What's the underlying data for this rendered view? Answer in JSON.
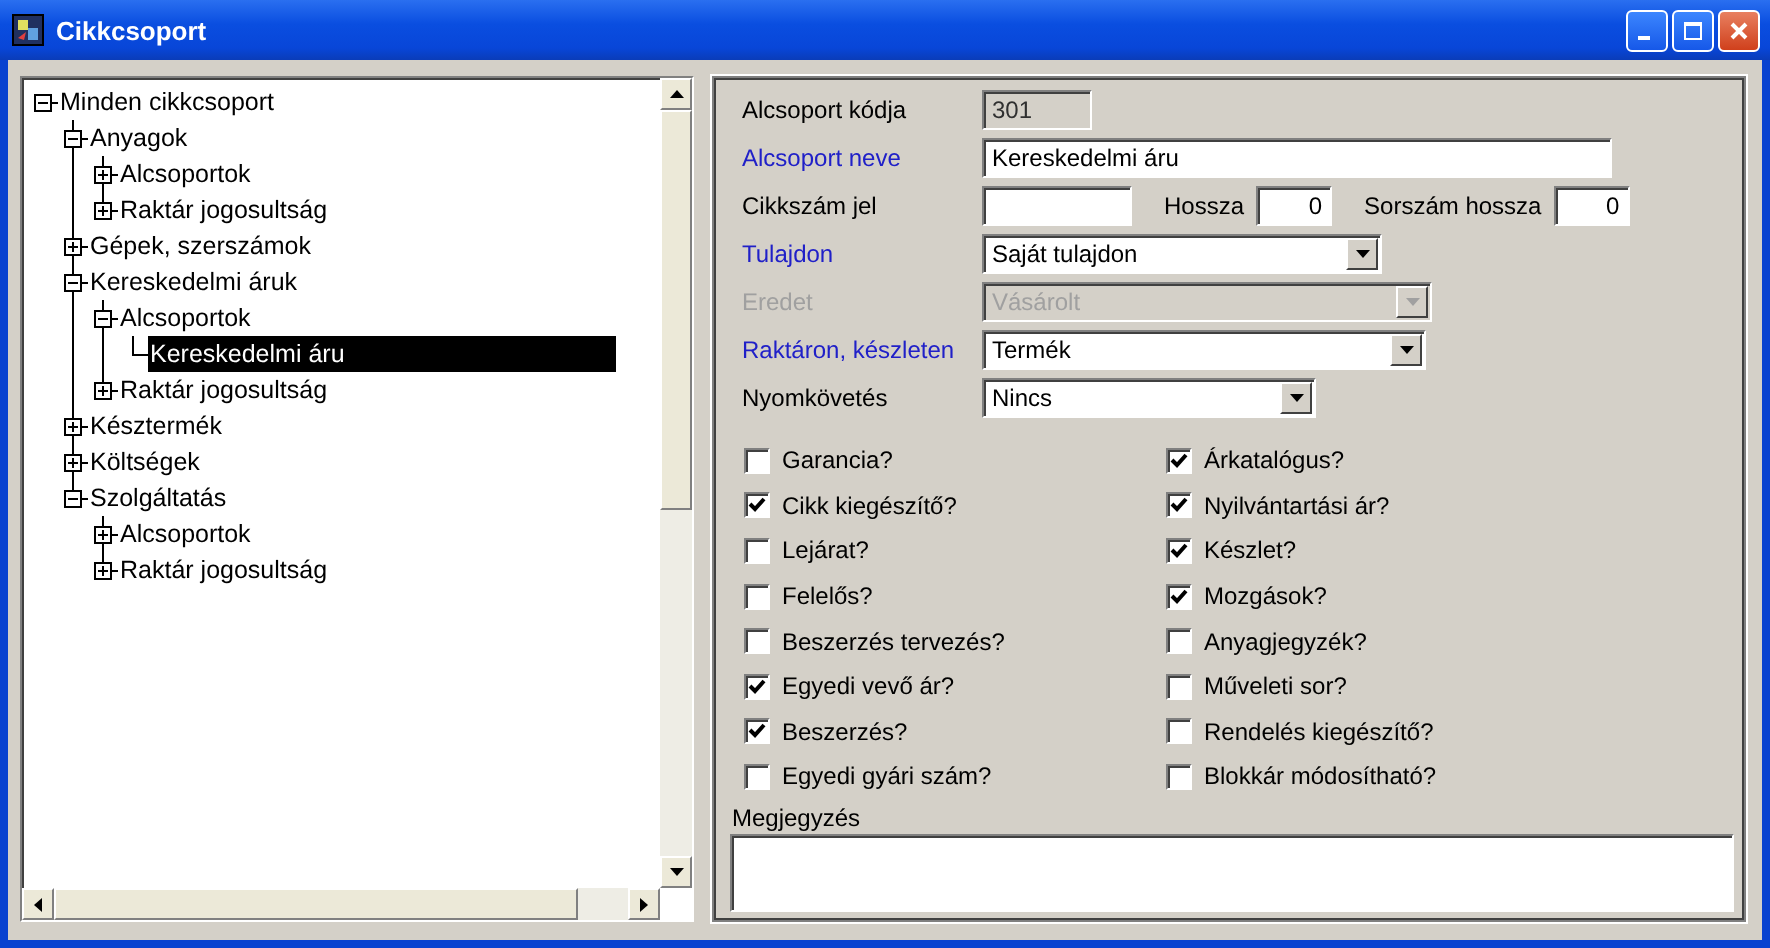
{
  "window": {
    "title": "Cikkcsoport"
  },
  "tree": [
    {
      "label": "Minden cikkcsoport",
      "expanded": true,
      "selected": false,
      "children": [
        {
          "label": "Anyagok",
          "expanded": true,
          "selected": false,
          "children": [
            {
              "label": "Alcsoportok",
              "expanded": false,
              "selected": false
            },
            {
              "label": "Raktár jogosultság",
              "expanded": false,
              "selected": false
            }
          ]
        },
        {
          "label": "Gépek, szerszámok",
          "expanded": false,
          "selected": false
        },
        {
          "label": "Kereskedelmi áruk",
          "expanded": true,
          "selected": false,
          "children": [
            {
              "label": "Alcsoportok",
              "expanded": true,
              "selected": false,
              "children": [
                {
                  "label": "Kereskedelmi áru",
                  "selected": true
                }
              ]
            },
            {
              "label": "Raktár jogosultság",
              "expanded": false,
              "selected": false
            }
          ]
        },
        {
          "label": "Késztermék",
          "expanded": false,
          "selected": false
        },
        {
          "label": "Költségek",
          "expanded": false,
          "selected": false
        },
        {
          "label": "Szolgáltatás",
          "expanded": true,
          "selected": false,
          "children": [
            {
              "label": "Alcsoportok",
              "expanded": false,
              "selected": false
            },
            {
              "label": "Raktár jogosultság",
              "expanded": false,
              "selected": false
            }
          ]
        }
      ]
    }
  ],
  "form": {
    "rows": [
      [
        {
          "label": "Alcsoport kódja",
          "kind": "readonly",
          "value": "301",
          "required": false,
          "disabled": false
        }
      ],
      [
        {
          "label": "Alcsoport neve",
          "kind": "text",
          "value": "Kereskedelmi áru",
          "required": true,
          "disabled": false
        }
      ],
      [
        {
          "label": "Cikkszám jel",
          "kind": "text",
          "required": false,
          "disabled": false
        },
        {
          "label": "Hossza",
          "kind": "number",
          "value": "0",
          "required": false,
          "disabled": false
        },
        {
          "label": "Sorszám hossza",
          "kind": "number",
          "value": "0",
          "required": false,
          "disabled": false
        }
      ],
      [
        {
          "label": "Tulajdon",
          "kind": "dropdown",
          "value": "Saját tulajdon",
          "required": true,
          "disabled": false
        }
      ],
      [
        {
          "label": "Eredet",
          "kind": "dropdown",
          "value": "Vásárolt",
          "required": false,
          "disabled": true
        }
      ],
      [
        {
          "label": "Raktáron, készleten",
          "kind": "dropdown",
          "value": "Termék",
          "required": true,
          "disabled": false
        }
      ],
      [
        {
          "label": "Nyomkövetés",
          "kind": "dropdown",
          "value": "Nincs",
          "required": false,
          "disabled": false
        }
      ]
    ],
    "checks": [
      {
        "label": "Garancia?",
        "checked": false
      },
      {
        "label": "Cikk kiegészítő?",
        "checked": true
      },
      {
        "label": "Lejárat?",
        "checked": false
      },
      {
        "label": "Felelős?",
        "checked": false
      },
      {
        "label": "Beszerzés tervezés?",
        "checked": false
      },
      {
        "label": "Egyedi vevő ár?",
        "checked": true
      },
      {
        "label": "Beszerzés?",
        "checked": true
      },
      {
        "label": "Egyedi gyári szám?",
        "checked": false
      },
      {
        "label": "Árkatalógus?",
        "checked": true
      },
      {
        "label": "Nyilvántartási ár?",
        "checked": true
      },
      {
        "label": "Készlet?",
        "checked": true
      },
      {
        "label": "Mozgások?",
        "checked": true
      },
      {
        "label": "Anyagjegyzék?",
        "checked": false
      },
      {
        "label": "Műveleti sor?",
        "checked": false
      },
      {
        "label": "Rendelés kiegészítő?",
        "checked": false
      },
      {
        "label": "Blokkár módosítható?",
        "checked": false
      }
    ],
    "memo": {
      "label": "Megjegyzés"
    }
  }
}
